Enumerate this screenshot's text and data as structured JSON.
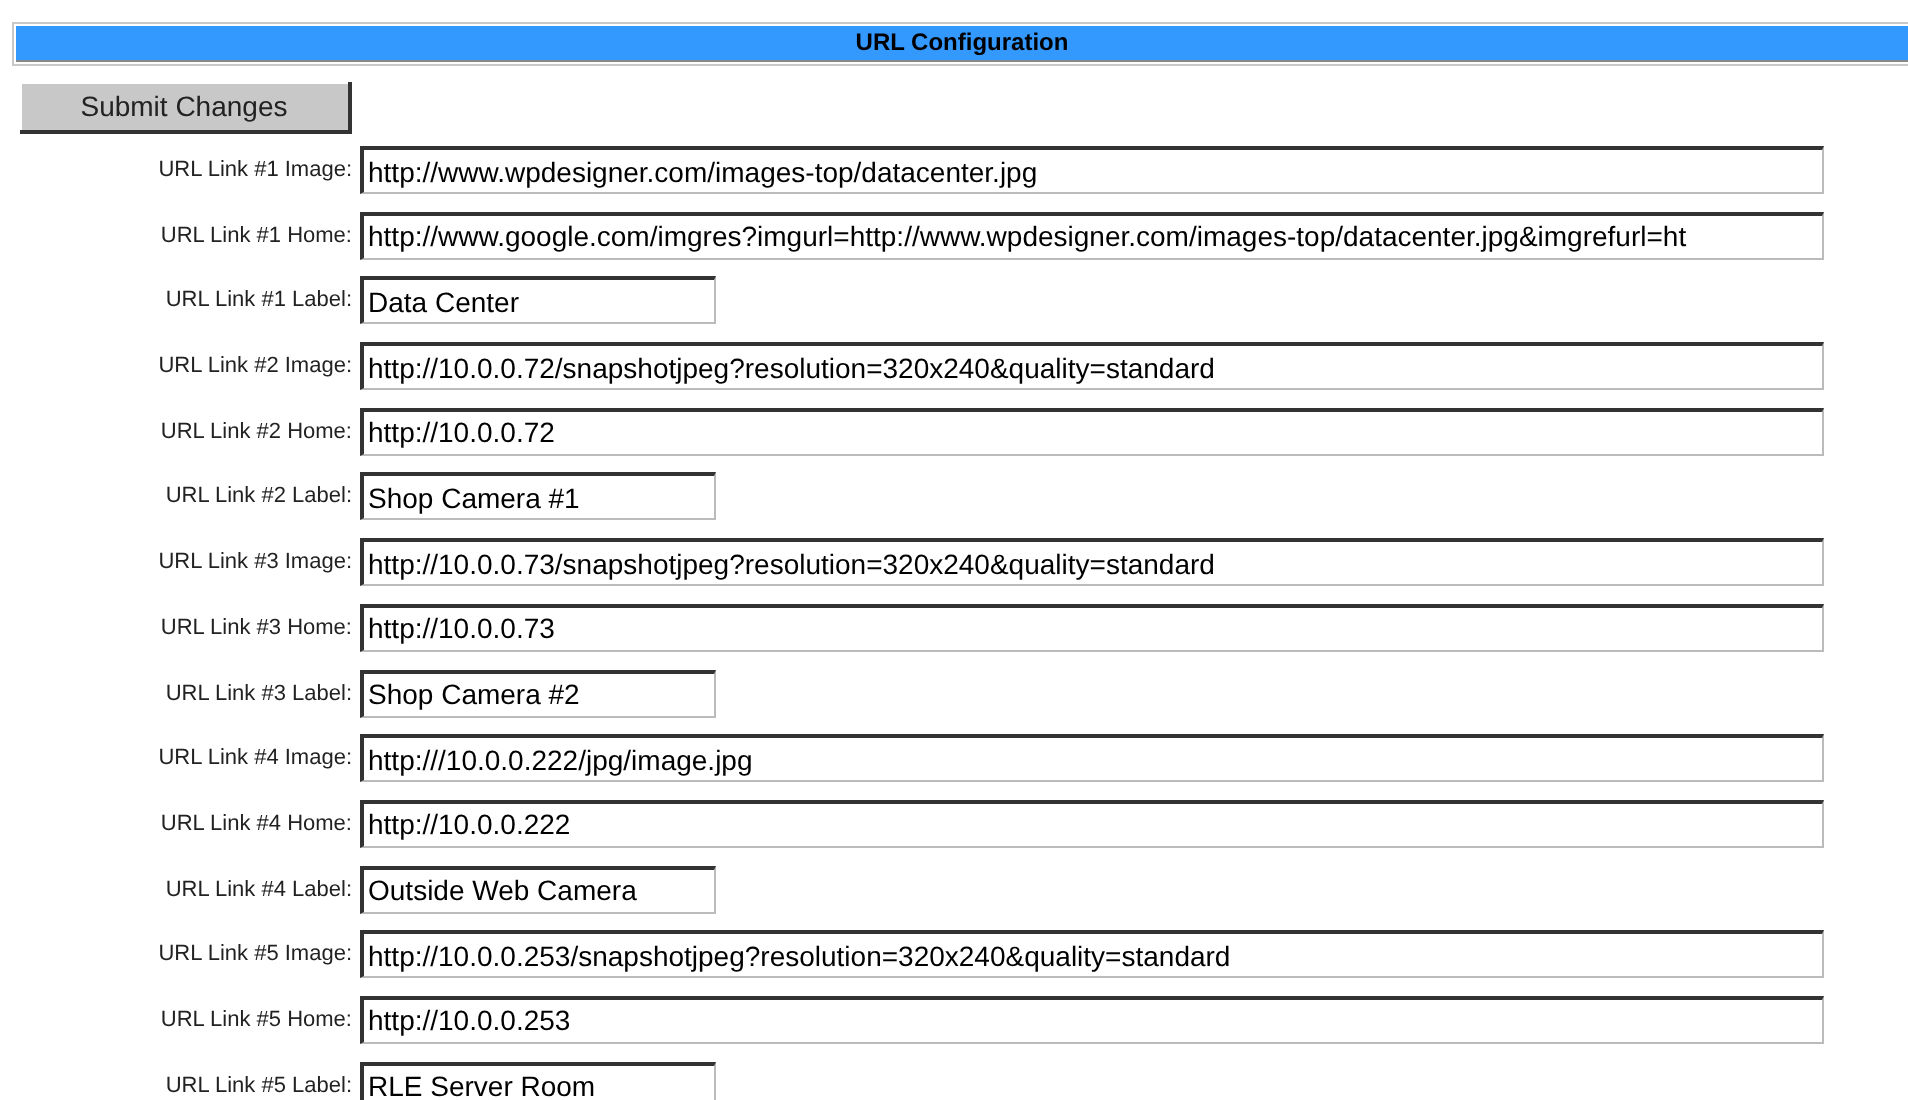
{
  "header": {
    "title": "URL Configuration"
  },
  "submit_button": "Submit Changes",
  "fields": [
    {
      "label": "URL Link #1 Image:",
      "kind": "url",
      "value": "http://www.wpdesigner.com/images-top/datacenter.jpg"
    },
    {
      "label": "URL Link #1 Home:",
      "kind": "url",
      "value": "http://www.google.com/imgres?imgurl=http://www.wpdesigner.com/images-top/datacenter.jpg&imgrefurl=ht"
    },
    {
      "label": "URL Link #1 Label:",
      "kind": "label",
      "value": "Data Center"
    },
    {
      "label": "URL Link #2 Image:",
      "kind": "url",
      "value": "http://10.0.0.72/snapshotjpeg?resolution=320x240&quality=standard"
    },
    {
      "label": "URL Link #2 Home:",
      "kind": "url",
      "value": "http://10.0.0.72"
    },
    {
      "label": "URL Link #2 Label:",
      "kind": "label",
      "value": "Shop Camera #1"
    },
    {
      "label": "URL Link #3 Image:",
      "kind": "url",
      "value": "http://10.0.0.73/snapshotjpeg?resolution=320x240&quality=standard"
    },
    {
      "label": "URL Link #3 Home:",
      "kind": "url",
      "value": "http://10.0.0.73"
    },
    {
      "label": "URL Link #3 Label:",
      "kind": "label",
      "value": "Shop Camera #2"
    },
    {
      "label": "URL Link #4 Image:",
      "kind": "url",
      "value": "http:///10.0.0.222/jpg/image.jpg"
    },
    {
      "label": "URL Link #4 Home:",
      "kind": "url",
      "value": "http://10.0.0.222"
    },
    {
      "label": "URL Link #4 Label:",
      "kind": "label",
      "value": "Outside Web Camera"
    },
    {
      "label": "URL Link #5 Image:",
      "kind": "url",
      "value": "http://10.0.0.253/snapshotjpeg?resolution=320x240&quality=standard"
    },
    {
      "label": "URL Link #5 Home:",
      "kind": "url",
      "value": "http://10.0.0.253"
    },
    {
      "label": "URL Link #5 Label:",
      "kind": "label",
      "value": "RLE Server Room"
    }
  ]
}
